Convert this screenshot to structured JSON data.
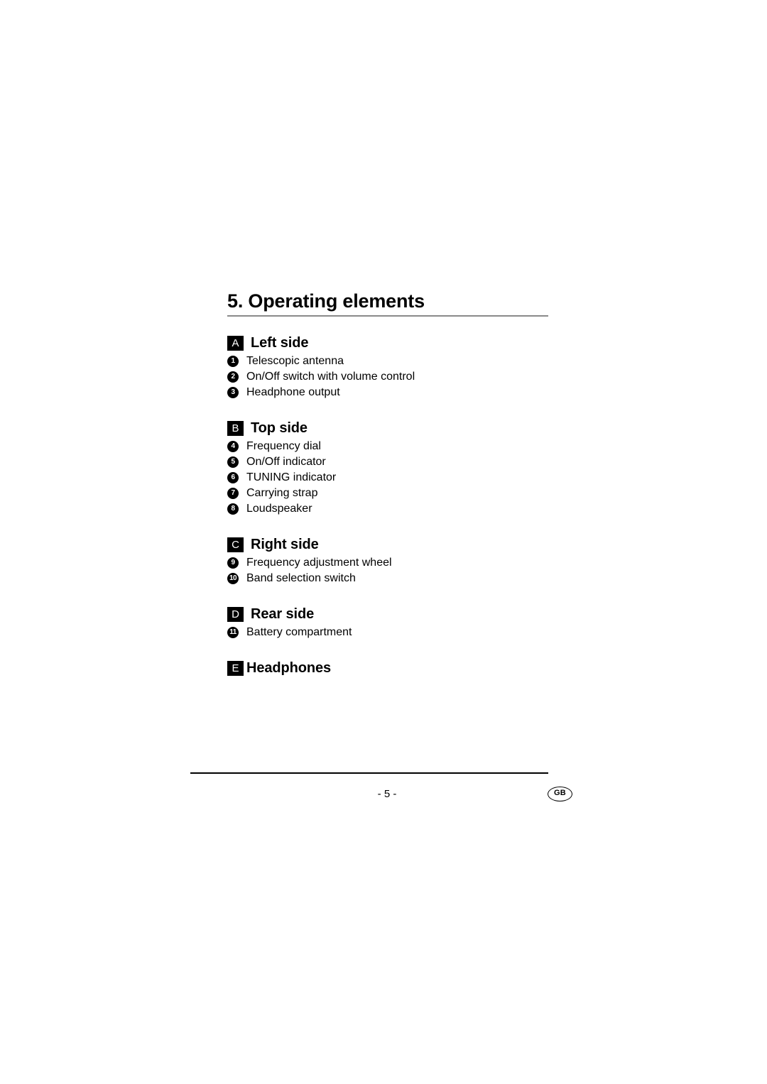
{
  "document": {
    "chapter_number_title": "5. Operating elements",
    "page_number": "- 5 -",
    "language_badge": "GB"
  },
  "sections": [
    {
      "badge": "A",
      "heading": "Left side",
      "items": [
        {
          "number": "1",
          "label": "Telescopic antenna"
        },
        {
          "number": "2",
          "label": "On/Off switch with volume control"
        },
        {
          "number": "3",
          "label": "Headphone output"
        }
      ]
    },
    {
      "badge": "B",
      "heading": "Top side",
      "items": [
        {
          "number": "4",
          "label": "Frequency dial"
        },
        {
          "number": "5",
          "label": "On/Off indicator"
        },
        {
          "number": "6",
          "label": "TUNING indicator"
        },
        {
          "number": "7",
          "label": "Carrying strap"
        },
        {
          "number": "8",
          "label": "Loudspeaker"
        }
      ]
    },
    {
      "badge": "C",
      "heading": "Right side",
      "items": [
        {
          "number": "9",
          "label": "Frequency adjustment wheel"
        },
        {
          "number": "10",
          "label": "Band selection switch"
        }
      ]
    },
    {
      "badge": "D",
      "heading": "Rear side",
      "items": [
        {
          "number": "11",
          "label": "Battery compartment"
        }
      ]
    },
    {
      "badge": "E",
      "heading": "Headphones",
      "items": []
    }
  ]
}
